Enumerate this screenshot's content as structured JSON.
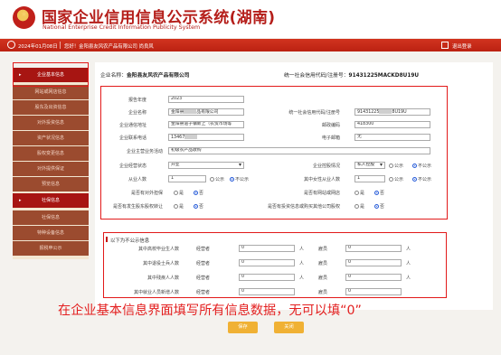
{
  "header": {
    "title": "国家企业信用信息公示系统(湖南)",
    "subtitle": "National Enterprise Credit Information Publicity System",
    "date": "2024年01月08日",
    "user_prefix": "您好！金阳县友风农产品有限公司 尚良风",
    "logout": "退出登录"
  },
  "sidebar": {
    "items": [
      {
        "label": "企业基本信息",
        "active": true
      },
      {
        "label": "网站或网店信息"
      },
      {
        "label": "股东及出资信息"
      },
      {
        "label": "对外投资信息"
      },
      {
        "label": "资产状况信息"
      },
      {
        "label": "股权变更信息"
      },
      {
        "label": "对外提供保证"
      },
      {
        "label": "预览信息"
      },
      {
        "label": "社保信息",
        "arrow": true
      },
      {
        "label": "社保信息"
      },
      {
        "label": "特种设备信息"
      },
      {
        "label": "报税申公示"
      }
    ]
  },
  "main": {
    "company_label": "企业名称：",
    "company_name": "金阳县友风农产品有限公司",
    "credit_label": "统一社会信用代码/注册号：",
    "credit_code": "91431225MACKD8U19U",
    "form": {
      "report_year_label": "报告年度",
      "report_year": "2023",
      "company_name_label": "企业名称",
      "company_name_value": "金阳县",
      "company_name_suffix": "品有限公司",
      "credit_code_label": "统一社会信用代码/注册号",
      "credit_code_value_a": "91431225",
      "credit_code_value_b": "8U19U",
      "address_label": "企业通信地址",
      "address": "金阳县道子镇新上（农贸市场等",
      "postcode_label": "邮政编码",
      "postcode": "418300",
      "phone_label": "企业联系电话",
      "phone": "13467",
      "email_label": "电子邮箱",
      "email": "无",
      "main_business_label": "企业主营业务活动",
      "main_business": "初级农产品收购",
      "status_label": "企业经营状态",
      "status": "开业",
      "holding_label": "企业控股情况",
      "holding": "私人控股",
      "holding_public": "公示",
      "holding_private": "不公示",
      "employees_label": "从业人数",
      "employees": "1",
      "employees_public": "公示",
      "employees_private": "不公示",
      "female_label": "其中女性从业人数",
      "female": "1",
      "female_public": "公示",
      "female_private": "不公示",
      "guarantee_label": "是否有对外担保",
      "online_label": "是否有网站或网店",
      "equity_transfer_label": "是否有发生股东股权转让",
      "other_invest_label": "是否有投资信息或购买其他公司股权",
      "yes": "是",
      "no": "否"
    },
    "section2": {
      "head": "以下为不公示信息",
      "rows": [
        {
          "label": "其中高校毕业生人数",
          "op": "经营者",
          "op_value": "0",
          "emp": "雇员",
          "emp_value": "0"
        },
        {
          "label": "其中退役士兵人数",
          "op": "经营者",
          "op_value": "0",
          "emp": "雇员",
          "emp_value": "0"
        },
        {
          "label": "其中残疾人人数",
          "op": "经营者",
          "op_value": "0",
          "emp": "雇员",
          "emp_value": "0"
        },
        {
          "label": "其中就业人员新增人数",
          "op": "经营者",
          "op_value": "0",
          "emp": "雇员",
          "emp_value": "0"
        }
      ],
      "unit": "人"
    },
    "caption": "在企业基本信息界面填写所有信息数据，无可以填“0”",
    "save": "保存",
    "close": "关闭"
  }
}
